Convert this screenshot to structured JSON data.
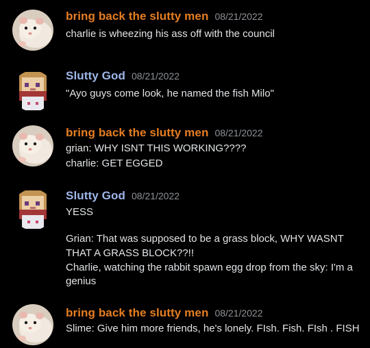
{
  "colors": {
    "background": "#000000",
    "username_orange": "#e67e22",
    "username_blue": "#9fb6ea",
    "timestamp": "#8e9297",
    "text": "#e3e5e8"
  },
  "messages": [
    {
      "author": "bring back the slutty men",
      "avatar": "hamster-avatar",
      "timestamp": "08/21/2022",
      "lines": [
        "charlie is wheezing his ass off with the council"
      ]
    },
    {
      "author": "Slutty God",
      "avatar": "minecraft-skin-avatar",
      "timestamp": "08/21/2022",
      "lines": [
        "\"Ayo guys come look, he named the fish Milo\""
      ]
    },
    {
      "author": "bring back the slutty men",
      "avatar": "hamster-avatar",
      "timestamp": "08/21/2022",
      "lines": [
        "grian: WHY ISNT THIS WORKING????",
        "charlie: GET EGGED"
      ]
    },
    {
      "author": "Slutty God",
      "avatar": "minecraft-skin-avatar",
      "timestamp": "08/21/2022",
      "lines": [
        "YESS",
        "",
        "Grian: That was supposed to be a grass block, WHY WASNT",
        "THAT A GRASS BLOCK??!!",
        "Charlie, watching the rabbit spawn egg drop from the sky: I'm a",
        "genius"
      ]
    },
    {
      "author": "bring back the slutty men",
      "avatar": "hamster-avatar",
      "timestamp": "08/21/2022",
      "lines": [
        "Slime: Give him more friends, he's lonely. FIsh. Fish. FIsh . FISH"
      ]
    }
  ]
}
